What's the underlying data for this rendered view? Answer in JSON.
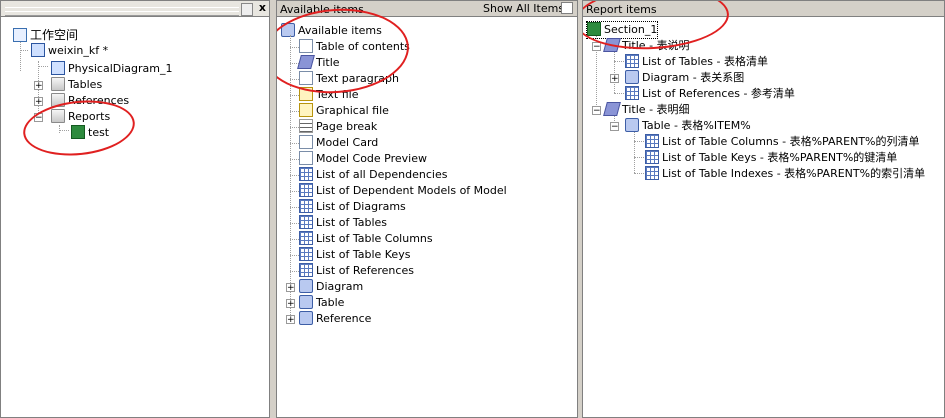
{
  "left": {
    "workspace": "工作空间",
    "model": "weixin_kf *",
    "diagram": "PhysicalDiagram_1",
    "tables": "Tables",
    "references": "References",
    "reports": "Reports",
    "report": "test",
    "close_btn": "x"
  },
  "middle": {
    "header": "Available items",
    "root": "Available items",
    "items": [
      "Table of contents",
      "Title",
      "Text paragraph",
      "Text file",
      "Graphical file",
      "Page break",
      "Model Card",
      "Model Code Preview",
      "List of all Dependencies",
      "List of Dependent Models of Model",
      "List of Diagrams",
      "List of Tables",
      "List of Table Columns",
      "List of Table Keys",
      "List of References"
    ],
    "groups": [
      "Diagram",
      "Table",
      "Reference"
    ]
  },
  "toolbar": {
    "show_all": "Show All Items"
  },
  "right": {
    "header": "Report items",
    "section": "Section_1",
    "title1": "Title - 表说明",
    "t1_children": [
      "List of Tables - 表格清单",
      "Diagram - 表关系图",
      "List of References - 参考清单"
    ],
    "title2": "Title - 表明细",
    "table_item": "Table - 表格%ITEM%",
    "table_children": [
      "List of Table Columns - 表格%PARENT%的列清单",
      "List of Table Keys - 表格%PARENT%的键清单",
      "List of Table Indexes - 表格%PARENT%的索引清单"
    ]
  }
}
